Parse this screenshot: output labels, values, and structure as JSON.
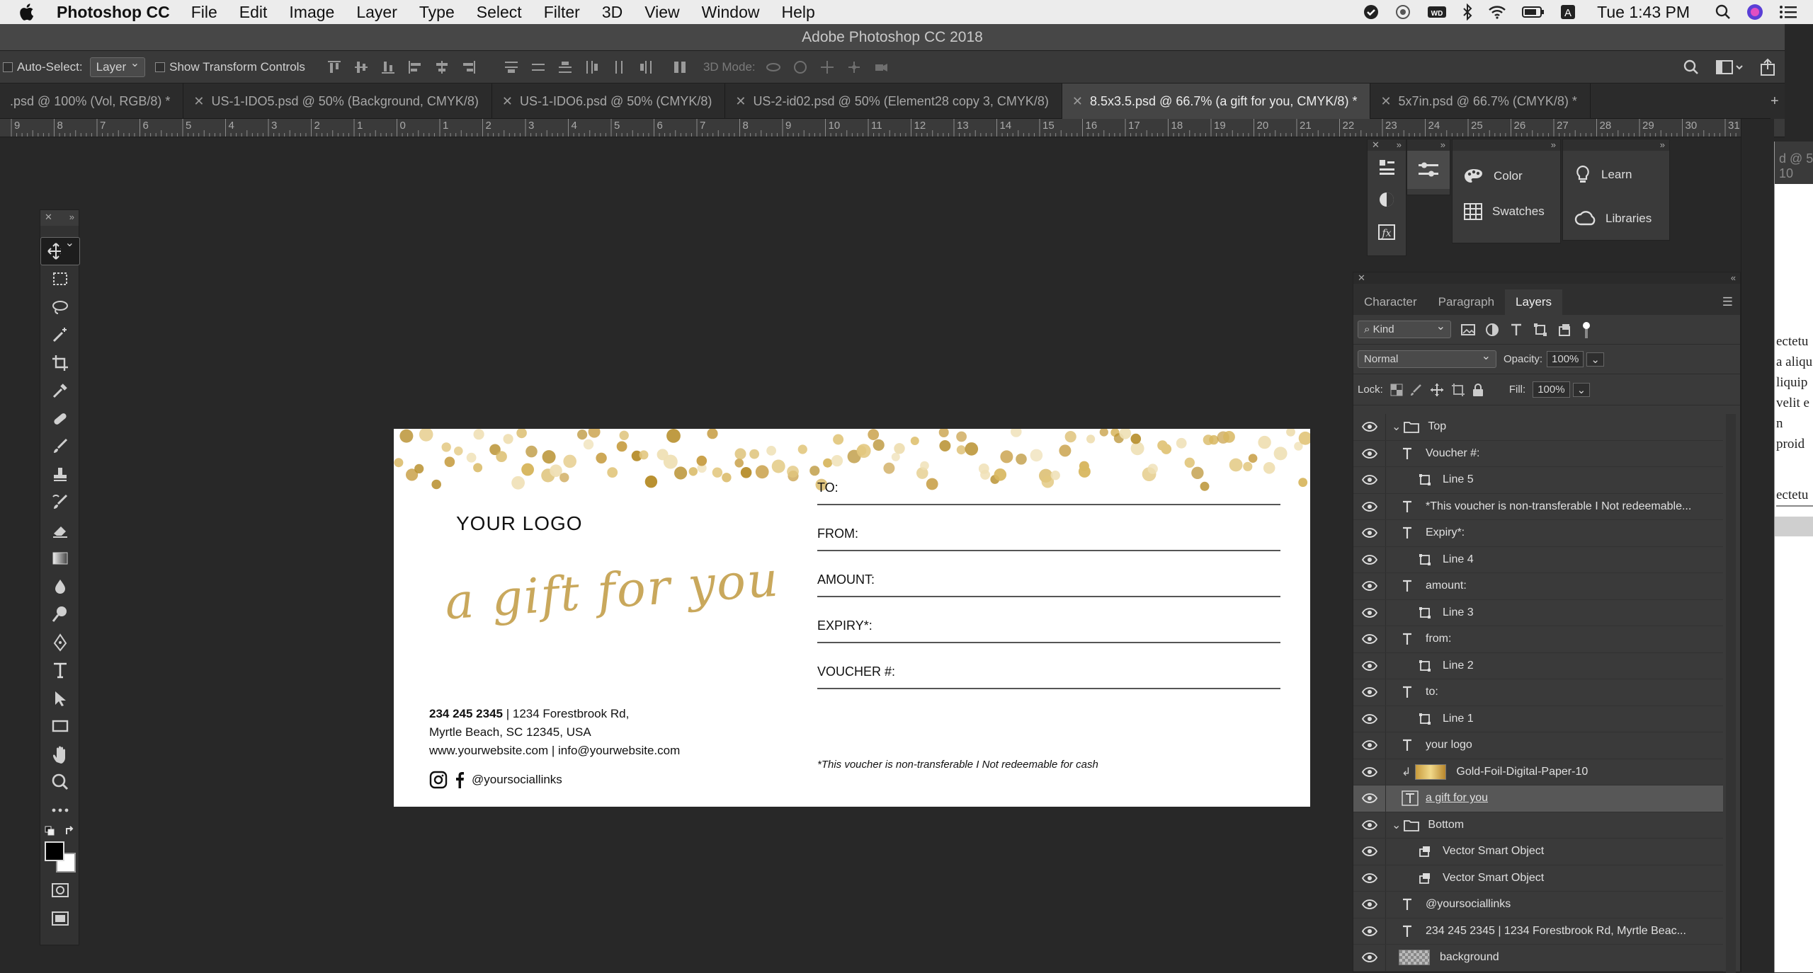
{
  "menubar": {
    "app_name": "Photoshop CC",
    "items": [
      "File",
      "Edit",
      "Image",
      "Layer",
      "Type",
      "Select",
      "Filter",
      "3D",
      "View",
      "Window",
      "Help"
    ],
    "clock": "Tue 1:43 PM"
  },
  "window_title": "Adobe Photoshop CC 2018",
  "options_bar": {
    "auto_select_label": "Auto-Select:",
    "auto_select_value": "Layer",
    "show_transform_label": "Show Transform Controls",
    "mode_3d_label": "3D Mode:"
  },
  "tabs": [
    {
      "label": ".psd @ 100% (Vol, RGB/8) *",
      "active": false
    },
    {
      "label": "US-1-IDO5.psd @ 50% (Background, CMYK/8)",
      "active": false
    },
    {
      "label": "US-1-IDO6.psd @ 50% (CMYK/8)",
      "active": false
    },
    {
      "label": "US-2-id02.psd @ 50% (Element28 copy 3, CMYK/8)",
      "active": false
    },
    {
      "label": "8.5x3.5.psd @ 66.7% (a gift for you, CMYK/8) *",
      "active": true
    },
    {
      "label": "5x7in.psd @ 66.7% (CMYK/8) *",
      "active": false
    }
  ],
  "ruler_labels": [
    "9",
    "8",
    "7",
    "6",
    "5",
    "4",
    "3",
    "2",
    "1",
    "0",
    "1",
    "2",
    "3",
    "4",
    "5",
    "6",
    "7",
    "8",
    "9",
    "10",
    "11",
    "12",
    "13",
    "14",
    "15",
    "16",
    "17",
    "18",
    "19",
    "20",
    "21",
    "22",
    "23",
    "24",
    "25",
    "26",
    "27",
    "28",
    "29",
    "30",
    "31"
  ],
  "document": {
    "logo": "YOUR LOGO",
    "headline": "a gift for you",
    "phone": "234 245 2345",
    "address_line1_rest": "| 1234 Forestbrook Rd,",
    "address_line2": "Myrtle Beach, SC 12345, USA",
    "address_line3": "www.yourwebsite.com | info@yourwebsite.com",
    "social": "@yoursociallinks",
    "fields": [
      "TO:",
      "FROM:",
      "AMOUNT:",
      "EXPIRY*:",
      "VOUCHER #:"
    ],
    "note": "*This voucher is non-transferable I Not redeemable for cash",
    "accent": "#c9a85c"
  },
  "mini_panels": {
    "color": "Color",
    "swatches": "Swatches",
    "learn": "Learn",
    "libraries": "Libraries"
  },
  "layers_panel": {
    "tabs": [
      "Character",
      "Paragraph",
      "Layers"
    ],
    "active_tab": "Layers",
    "filter_kind": "Kind",
    "blend_mode": "Normal",
    "opacity_label": "Opacity:",
    "opacity_value": "100%",
    "lock_label": "Lock:",
    "fill_label": "Fill:",
    "fill_value": "100%",
    "layers": [
      {
        "name": "Top",
        "type": "group",
        "indent": 0,
        "active": false
      },
      {
        "name": "Voucher #:",
        "type": "text",
        "indent": 1,
        "active": false
      },
      {
        "name": "Line 5",
        "type": "shape",
        "indent": 2,
        "active": false
      },
      {
        "name": "*This voucher is non-transferable I Not redeemable...",
        "type": "text",
        "indent": 1,
        "active": false
      },
      {
        "name": "Expiry*:",
        "type": "text",
        "indent": 1,
        "active": false
      },
      {
        "name": "Line 4",
        "type": "shape",
        "indent": 2,
        "active": false
      },
      {
        "name": "amount:",
        "type": "text",
        "indent": 1,
        "active": false
      },
      {
        "name": "Line 3",
        "type": "shape",
        "indent": 2,
        "active": false
      },
      {
        "name": "from:",
        "type": "text",
        "indent": 1,
        "active": false
      },
      {
        "name": "Line 2",
        "type": "shape",
        "indent": 2,
        "active": false
      },
      {
        "name": "to:",
        "type": "text",
        "indent": 1,
        "active": false
      },
      {
        "name": "Line 1",
        "type": "shape",
        "indent": 2,
        "active": false
      },
      {
        "name": "your logo",
        "type": "text",
        "indent": 1,
        "active": false
      },
      {
        "name": "Gold-Foil-Digital-Paper-10",
        "type": "image",
        "indent": 1,
        "active": false
      },
      {
        "name": "a gift for you",
        "type": "text-box",
        "indent": 1,
        "active": true
      },
      {
        "name": "Bottom",
        "type": "group",
        "indent": 0,
        "active": false
      },
      {
        "name": "Vector Smart Object",
        "type": "smart",
        "indent": 2,
        "active": false
      },
      {
        "name": "Vector Smart Object",
        "type": "smart",
        "indent": 2,
        "active": false
      },
      {
        "name": "@yoursociallinks",
        "type": "text",
        "indent": 1,
        "active": false
      },
      {
        "name": "234 245 2345 | 1234 Forestbrook Rd,  Myrtle Beac...",
        "type": "text",
        "indent": 1,
        "active": false
      },
      {
        "name": "background",
        "type": "bg",
        "indent": 0,
        "active": false
      }
    ]
  },
  "right_dock_text": [
    "ectetu",
    "a aliqu",
    "liquip",
    "velit e",
    "n proid",
    "ectetu"
  ]
}
